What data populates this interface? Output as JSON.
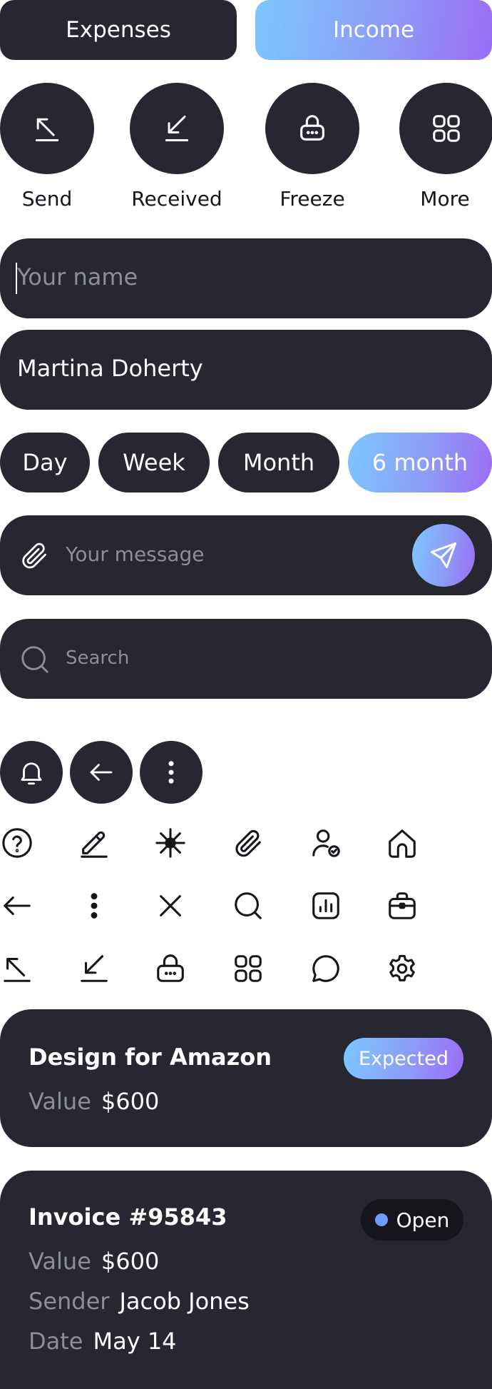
{
  "segmented": {
    "expenses": "Expenses",
    "income": "Income"
  },
  "quick_actions": [
    {
      "label": "Send",
      "icon": "arrow-up-left-icon"
    },
    {
      "label": "Received",
      "icon": "arrow-down-left-icon"
    },
    {
      "label": "Freeze",
      "icon": "lock-icon"
    },
    {
      "label": "More",
      "icon": "grid-icon"
    }
  ],
  "name_input": {
    "placeholder": "Your name"
  },
  "name_filled": {
    "value": "Martina Doherty"
  },
  "periods": [
    "Day",
    "Week",
    "Month",
    "6 month"
  ],
  "periods_active": "6 month",
  "message_input": {
    "placeholder": "Your message"
  },
  "search_input": {
    "placeholder": "Search"
  },
  "icons": {
    "round": [
      "bell-icon",
      "arrow-left-icon",
      "more-vertical-icon"
    ],
    "row1": [
      "help-icon",
      "edit-icon",
      "sparkle-icon",
      "paperclip-icon",
      "user-check-icon",
      "home-icon"
    ],
    "row2": [
      "arrow-left-icon",
      "more-vertical-icon",
      "close-icon",
      "search-icon",
      "chart-icon",
      "briefcase-icon"
    ],
    "row3": [
      "arrow-up-left-icon",
      "arrow-down-left-icon",
      "lock-icon",
      "grid-icon",
      "chat-icon",
      "settings-icon"
    ]
  },
  "card1": {
    "title": "Design for Amazon",
    "badge": "Expected",
    "value_label": "Value",
    "value": "$600"
  },
  "card2": {
    "title": "Invoice #95843",
    "badge": "Open",
    "rows": [
      {
        "label": "Value",
        "value": "$600"
      },
      {
        "label": "Sender",
        "value": "Jacob Jones"
      },
      {
        "label": "Date",
        "value": "May 14"
      }
    ]
  },
  "colors": {
    "surface": "#262730",
    "accent_start": "#7cc7ff",
    "accent_end": "#9c6cf6",
    "open_dot": "#6e9cf7",
    "muted_text": "#8d8e98"
  }
}
